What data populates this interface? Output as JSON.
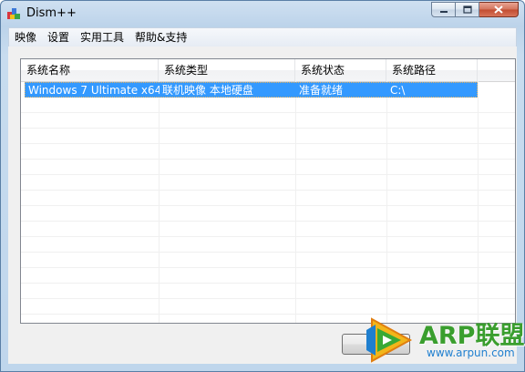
{
  "window": {
    "title": "Dism++",
    "controls": {
      "minimize": "minimize-icon",
      "maximize": "maximize-icon",
      "close": "close-icon"
    }
  },
  "menu": {
    "items": [
      {
        "label": "映像"
      },
      {
        "label": "设置"
      },
      {
        "label": "实用工具"
      },
      {
        "label": "帮助&支持"
      }
    ]
  },
  "list": {
    "columns": [
      "系统名称",
      "系统类型",
      "系统状态",
      "系统路径"
    ],
    "rows": [
      {
        "name": "Windows 7 Ultimate x64",
        "type": "联机映像 本地硬盘",
        "status": "准备就绪",
        "path": "C:\\",
        "selected": true
      }
    ]
  },
  "colors": {
    "selection": "#3399ff",
    "watermark_green": "#3a9e2e",
    "watermark_blue": "#1f7fcf"
  },
  "watermark": {
    "brand": "ARP联盟",
    "url": "www.arpun.com"
  }
}
